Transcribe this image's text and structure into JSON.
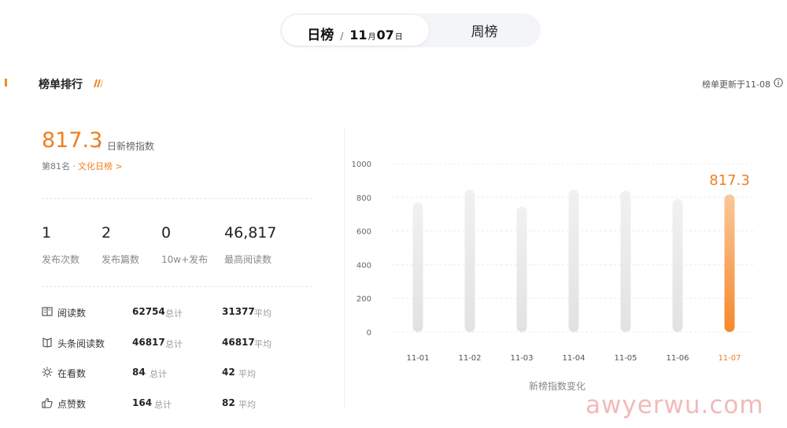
{
  "tabs": {
    "daily_label": "日榜",
    "separator": "/",
    "month": "11",
    "month_unit": "月",
    "day": "07",
    "day_unit": "日",
    "weekly_label": "周榜"
  },
  "section": {
    "title": "榜单排行",
    "updated": "榜单更新于11-08"
  },
  "score": {
    "value": "817.3",
    "separator": "/",
    "label": "日新榜指数",
    "rank": "第81名 ·",
    "rank_link": "文化日榜 >"
  },
  "stats": [
    {
      "value": "1",
      "label": "发布次数"
    },
    {
      "value": "2",
      "label": "发布篇数"
    },
    {
      "value": "0",
      "label": "10w+发布"
    },
    {
      "value": "46,817",
      "label": "最高阅读数"
    }
  ],
  "metrics": [
    {
      "icon": "book-icon",
      "name": "阅读数",
      "total": "62754",
      "total_label": "· 总计",
      "avg": "31377",
      "avg_label": "· 平均"
    },
    {
      "icon": "headline-book-icon",
      "name": "头条阅读数",
      "total": "46817",
      "total_label": "· 总计",
      "avg": "46817",
      "avg_label": "· 平均"
    },
    {
      "icon": "sun-icon",
      "name": "在看数",
      "total": "84",
      "total_label": "· 总计",
      "avg": "42",
      "avg_label": "· 平均"
    },
    {
      "icon": "thumbs-up-icon",
      "name": "点赞数",
      "total": "164",
      "total_label": "· 总计",
      "avg": "82",
      "avg_label": "· 平均"
    }
  ],
  "chart_data": {
    "type": "bar",
    "categories": [
      "11-01",
      "11-02",
      "11-03",
      "11-04",
      "11-05",
      "11-06",
      "11-07"
    ],
    "values": [
      770,
      845,
      745,
      845,
      840,
      790,
      817.3
    ],
    "highlight_index": 6,
    "highlight_label": "817.3",
    "title": "新榜指数变化",
    "ylim": [
      0,
      1000
    ],
    "yticks": [
      "0",
      "200",
      "400",
      "600",
      "800",
      "1000"
    ],
    "grid": true,
    "colors": {
      "bar": "#e6e6e8",
      "highlight": "#f5892a",
      "accent": "#f07f1f"
    }
  },
  "watermark": "awyerwu.com"
}
